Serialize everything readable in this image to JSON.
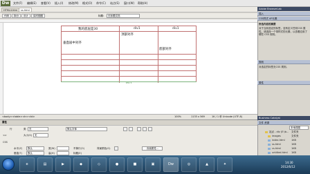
{
  "app": {
    "logo": "Dw",
    "menu": [
      "文件(F)",
      "编辑(E)",
      "查看(V)",
      "插入(I)",
      "修改(M)",
      "格式(O)",
      "命令(C)",
      "站点(S)",
      "窗口(W)",
      "帮助(H)"
    ],
    "watermark": "优酷"
  },
  "doc_tabs": [
    "HTML4.htm",
    "ss.html"
  ],
  "view_buttons": [
    "代码",
    "拆分",
    "设计",
    "实时视图"
  ],
  "title_label": "标题:",
  "title_value": "无标题文档",
  "table": {
    "header_cells": [
      "我的底层是30",
      "div1",
      "div1"
    ],
    "row1_texts": [
      "垂直居中对齐",
      "顶部对齐",
      "底部对齐"
    ],
    "width_label": "651 ▾"
  },
  "status": {
    "path": "<body><table><tr><td>",
    "zoom": "100%",
    "size": "1133 x 569",
    "info": "1K / 1 秒  Unicode (UTF-8)"
  },
  "props": {
    "title": "属性",
    "format_label": "行",
    "horz_label": "水平(Z)",
    "horz_value": "默认",
    "vert_label": "垂直(T)",
    "vert_value": "默认",
    "width_label": "宽(W)",
    "height_label": "高(H)",
    "nowrap_label": "不换行(O)",
    "bg_label": "背景颜色(G)",
    "header_label": "标题(E)",
    "class_label": "类",
    "class_value": "无",
    "font_value": "默认字体",
    "size_label": "大小(S)",
    "size_value": "无",
    "page_props_button": "页面属性..."
  },
  "right_panel": {
    "header": "Adobe BrowserLab",
    "section1_title": "插入",
    "section1_sub": "CSS样式 AP元素",
    "css_heading": "所选内容的摘要",
    "css_desc": "对于当前选定的标签，没有定义任何CSS 属性。请选择一个带样式的元素，以查看应用了哪些 CSS 规则。",
    "rules_title": "规则",
    "rules_desc": "对选定的标签无CSS 规则。",
    "props_title": "属性",
    "business_header": "Business Catalyst",
    "files_header": "文件  资源",
    "site_label": "本地视图",
    "files": [
      {
        "name": "站点 - div (E:\\b...",
        "size": "文件夹"
      },
      {
        "name": "images",
        "size": "文件夹"
      },
      {
        "name": "index.html",
        "size": "1KB"
      },
      {
        "name": "ss.html",
        "size": "1KB"
      },
      {
        "name": "cs.html",
        "size": "1KB"
      },
      {
        "name": "untitled.html",
        "size": "1KB"
      }
    ],
    "log_label": "日志..."
  },
  "taskbar": {
    "time": "14:30",
    "date": "2012/6/12"
  },
  "colors": {
    "table_border": "#c07070",
    "panel_header": "#3d4a64",
    "taskbar": "#1b3a56"
  }
}
